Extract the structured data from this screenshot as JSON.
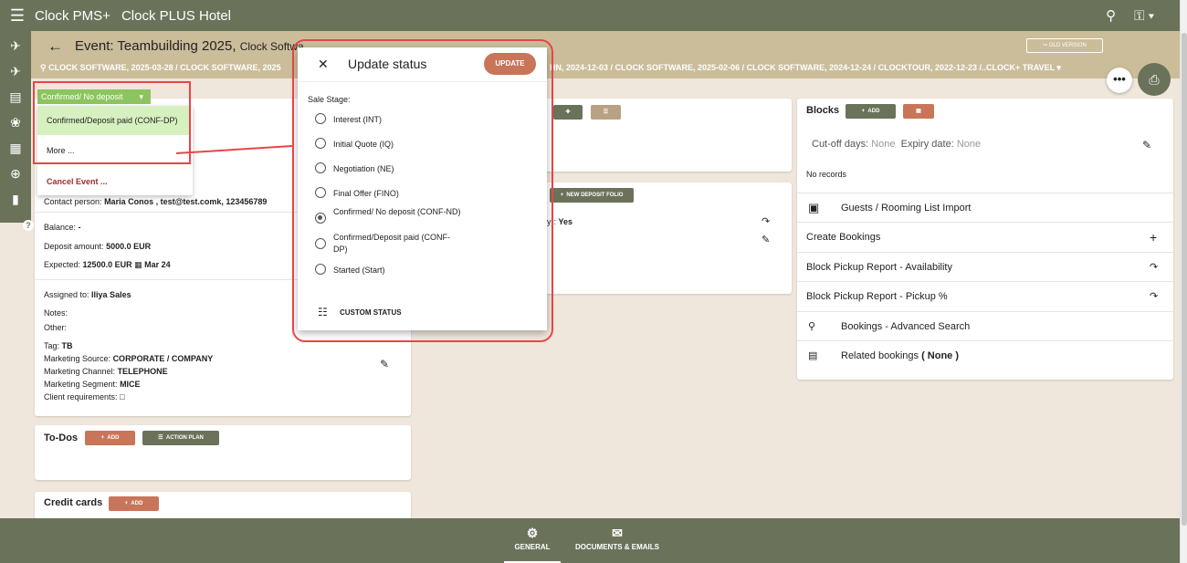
{
  "app": {
    "brand": "Clock PMS+",
    "hotel": "Clock PLUS Hotel"
  },
  "header": {
    "title": "Event: Teambuilding 2025,",
    "title_suffix": "Clock Softwa",
    "old_version": "OLD VERSION",
    "crumbs_left": "CLOCK SOFTWARE, 2025-03-28  /  CLOCK SOFTWARE, 2025",
    "crumbs_right": "HN, 2024-12-03  /  CLOCK SOFTWARE, 2025-02-06  /  CLOCK SOFTWARE, 2024-12-24  /  CLOCKTOUR, 2022-12-23  /..CLOCK+ TRAVEL"
  },
  "status_chip": "Confirmed/ No deposit",
  "dropdown": {
    "option_1": "Confirmed/Deposit paid (CONF-DP)",
    "option_2": "More ...",
    "option_3": "Cancel Event ..."
  },
  "details": {
    "contact_label": "Contact person:",
    "contact_value": "Maria Conos , test@test.comk, 123456789",
    "balance_label": "Balance:",
    "balance_value": "-",
    "deposit_label": "Deposit amount:",
    "deposit_value": "5000.0 EUR",
    "expected_label": "Expected:",
    "expected_value": "12500.0 EUR",
    "expected_date": "Mar 24",
    "assigned_label": "Assigned to:",
    "assigned_value": "Iliya  Sales",
    "notes_label": "Notes:",
    "other_label": "Other:",
    "tag_label": "Tag:",
    "tag_value": "TB",
    "mkt_source_label": "Marketing Source:",
    "mkt_source_value": "CORPORATE / COMPANY",
    "mkt_channel_label": "Marketing Channel:",
    "mkt_channel_value": "TELEPHONE",
    "mkt_segment_label": "Marketing Segment:",
    "mkt_segment_value": "MICE",
    "client_req_label": "Client requirements:"
  },
  "todos": {
    "title": "To-Dos",
    "add": "ADD",
    "action_plan": "ACTION PLAN"
  },
  "credit_cards": {
    "title": "Credit cards",
    "add": "ADD"
  },
  "middle": {
    "new_deposit_folio": "NEW DEPOSIT FOLIO",
    "partial_label": "ny):",
    "partial_value": "Yes"
  },
  "modal": {
    "title": "Update status",
    "update": "UPDATE",
    "sale_stage": "Sale Stage:",
    "options": [
      {
        "label": "Interest (INT)",
        "checked": false
      },
      {
        "label": "Initial Quote (IQ)",
        "checked": false
      },
      {
        "label": "Negotiation (NE)",
        "checked": false
      },
      {
        "label": "Final Offer (FINO)",
        "checked": false
      },
      {
        "label": "Confirmed/ No deposit (CONF-ND)",
        "checked": true
      },
      {
        "label": "Confirmed/Deposit paid (CONF-DP)",
        "checked": false
      },
      {
        "label": "Started (Start)",
        "checked": false
      }
    ],
    "custom_status": "CUSTOM STATUS"
  },
  "blocks": {
    "title": "Blocks",
    "add": "ADD",
    "cutoff_label": "Cut-off days:",
    "cutoff_value": "None",
    "expiry_label": "Expiry date:",
    "expiry_value": "None",
    "no_records": "No records",
    "items": [
      "Guests / Rooming List Import",
      "Create Bookings",
      "Block Pickup Report - Availability",
      "Block Pickup Report - Pickup %",
      "Bookings - Advanced Search",
      "Related bookings"
    ],
    "related_value": "( None )"
  },
  "footer": {
    "general": "GENERAL",
    "documents": "DOCUMENTS & EMAILS"
  },
  "colors": {
    "brand": "#6a735a",
    "accent": "#c87559",
    "header": "#cbbd9a",
    "highlight": "#e64646",
    "chip": "#8cc45f"
  }
}
